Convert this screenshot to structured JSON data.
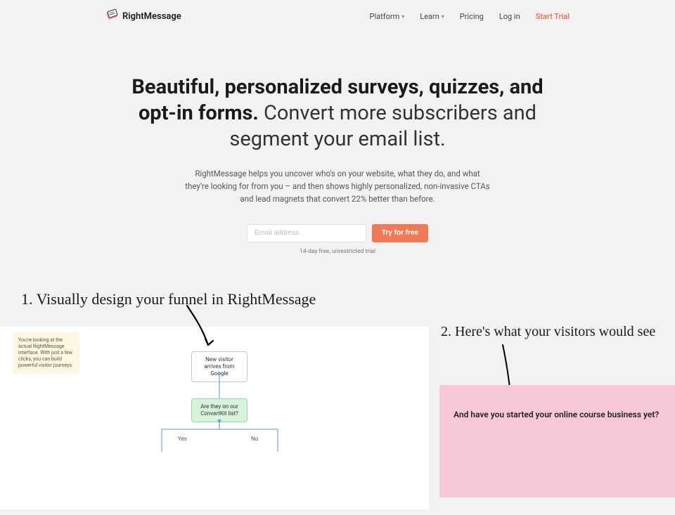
{
  "nav": {
    "brand": "RightMessage",
    "items": [
      {
        "label": "Platform",
        "has_dropdown": true
      },
      {
        "label": "Learn",
        "has_dropdown": true
      },
      {
        "label": "Pricing",
        "has_dropdown": false
      },
      {
        "label": "Log in",
        "has_dropdown": false
      }
    ],
    "cta": "Start Trial"
  },
  "hero": {
    "headline_bold": "Beautiful, personalized surveys, quizzes, and opt-in forms.",
    "headline_light": " Convert more subscribers and segment your email list.",
    "subtext": "RightMessage helps you uncover who's on your website, what they do, and what they're looking for from you – and then shows highly personalized, non-invasive CTAs and lead magnets that convert 22% better than before.",
    "email_placeholder": "Email address",
    "cta_button": "Try for free",
    "trial_note": "14-day free, unrestricted trial"
  },
  "steps": {
    "step1_label": "1. Visually design your funnel in RightMessage",
    "step2_label": "2. Here's what your visitors would see",
    "tooltip": "You're looking at the actual RightMessage interface. With just a few clicks, you can build powerful visitor journeys.",
    "flow": {
      "start_node": "New visitor arrives from Google",
      "decision_node": "Are they on our ConvertKit list?",
      "branch_yes": "Yes",
      "branch_no": "No"
    },
    "visitor_question": "And have you started your online course business yet?"
  }
}
